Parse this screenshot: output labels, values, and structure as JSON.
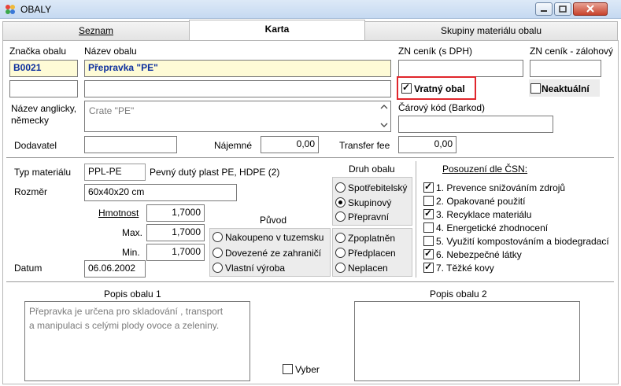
{
  "window": {
    "title": "OBALY"
  },
  "tabs": [
    {
      "label": "Seznam"
    },
    {
      "label": "Karta"
    },
    {
      "label": "Skupiny materiálu obalu"
    }
  ],
  "form": {
    "znacka_label": "Značka obalu",
    "znacka_value": "B0021",
    "nazev_label": "Název obalu",
    "nazev_value": "Přepravka \"PE\"",
    "zn_cenik_label": "ZN ceník (s DPH)",
    "zn_cenik_value": "",
    "zn_zalohovy_label": "ZN ceník - zálohový",
    "zn_zalohovy_value": "",
    "vratny_label": "Vratný obal",
    "vratny_checked": true,
    "neaktualni_label": "Neaktuální",
    "neaktualni_checked": false,
    "nazev_anglicky_label_1": "Název anglicky,",
    "nazev_anglicky_label_2": "německy",
    "nazev_anglicky_value": "Crate \"PE\"",
    "carovy_kod_label": "Čárový kód (Barkod)",
    "carovy_kod_value": "",
    "dodavatel_label": "Dodavatel",
    "dodavatel_value": "",
    "najemne_label": "Nájemné",
    "najemne_value": "0,00",
    "transfer_fee_label": "Transfer fee",
    "transfer_fee_value": "0,00",
    "typ_materialu_label": "Typ materiálu",
    "typ_materialu_value": "PPL-PE",
    "typ_materialu_desc": "Pevný dutý plast PE,  HDPE (2)",
    "rozmer_label": "Rozměr",
    "rozmer_value": "60x40x20 cm",
    "hmotnost_label": "Hmotnost",
    "hmotnost_value": "1,7000",
    "max_label": "Max.",
    "max_value": "1,7000",
    "min_label": "Min.",
    "min_value": "1,7000",
    "datum_label": "Datum",
    "datum_value": "06.06.2002"
  },
  "puvod": {
    "title": "Původ",
    "options": [
      {
        "label": "Nakoupeno v tuzemsku",
        "selected": false
      },
      {
        "label": "Dovezené ze zahraničí",
        "selected": false
      },
      {
        "label": "Vlastní výroba",
        "selected": false
      }
    ]
  },
  "druh_obalu": {
    "title": "Druh obalu",
    "options": [
      {
        "label": "Spotřebitelský",
        "selected": false
      },
      {
        "label": "Skupinový",
        "selected": true
      },
      {
        "label": "Přepravní",
        "selected": false
      }
    ],
    "options2": [
      {
        "label": "Zpoplatněn",
        "selected": false
      },
      {
        "label": "Předplacen",
        "selected": false
      },
      {
        "label": "Neplacen",
        "selected": false
      }
    ]
  },
  "posouzeni": {
    "title": "Posouzení dle ČSN:",
    "items": [
      {
        "label": "1. Prevence snižováním zdrojů",
        "checked": true
      },
      {
        "label": "2. Opakované použití",
        "checked": false
      },
      {
        "label": "3. Recyklace materiálu",
        "checked": true
      },
      {
        "label": "4. Energetické zhodnocení",
        "checked": false
      },
      {
        "label": "5. Využití kompostováním a biodegradací",
        "checked": false
      },
      {
        "label": "6. Nebezpečné látky",
        "checked": true
      },
      {
        "label": "7. Těžké kovy",
        "checked": true
      }
    ]
  },
  "popis": {
    "popis1_label": "Popis obalu 1",
    "popis1_value_1": "Přepravka je určena pro  skladování , transport",
    "popis1_value_2": "a manipulaci s celými plody ovoce a zeleniny.",
    "popis2_label": "Popis obalu 2",
    "popis2_value": "",
    "vyber_label": "Vyber",
    "vyber_checked": false
  },
  "colors": {
    "accent_blue": "#0c2f9e",
    "yellow_field": "#fefbd6",
    "highlight_red": "#e0262c"
  }
}
